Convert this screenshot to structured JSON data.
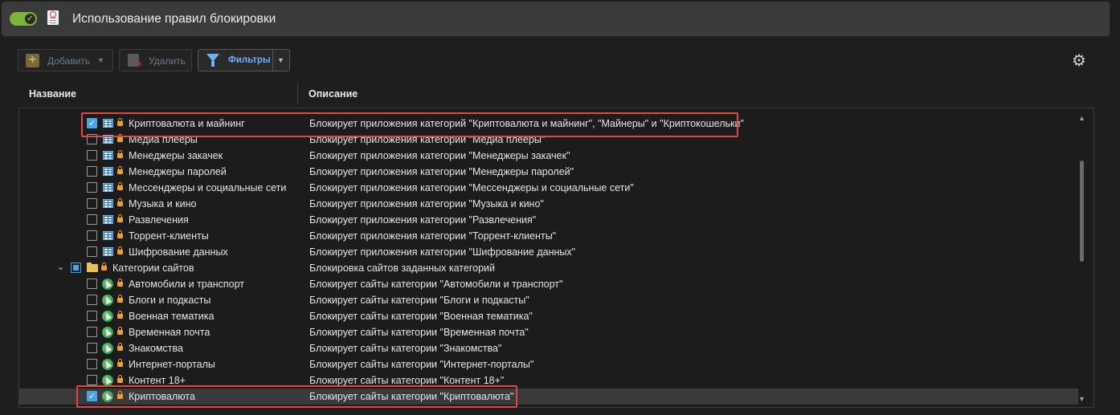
{
  "header": {
    "title": "Использование правил блокировки",
    "toggle_on": true
  },
  "toolbar": {
    "add_label": "Добавить",
    "delete_label": "Удалить",
    "filters_label": "Фильтры"
  },
  "columns": {
    "name": "Название",
    "description": "Описание"
  },
  "rows": [
    {
      "name": "Криптовалюта и майнинг",
      "desc": "Блокирует приложения категорий \"Криптовалюта и майнинг\", \"Майнеры\" и \"Криптокошельки\"",
      "checked": true,
      "icon": "app-icon"
    },
    {
      "name": "Медиа плееры",
      "desc": "Блокирует приложения категории \"Медиа плееры\"",
      "checked": false,
      "icon": "app-icon"
    },
    {
      "name": "Менеджеры закачек",
      "desc": "Блокирует приложения категории \"Менеджеры закачек\"",
      "checked": false,
      "icon": "app-icon"
    },
    {
      "name": "Менеджеры паролей",
      "desc": "Блокирует приложения категории \"Менеджеры паролей\"",
      "checked": false,
      "icon": "app-icon"
    },
    {
      "name": "Мессенджеры и социальные сети",
      "desc": "Блокирует приложения категории \"Мессенджеры и социальные сети\"",
      "checked": false,
      "icon": "app-icon"
    },
    {
      "name": "Музыка и кино",
      "desc": "Блокирует приложения категории \"Музыка и кино\"",
      "checked": false,
      "icon": "app-icon"
    },
    {
      "name": "Развлечения",
      "desc": "Блокирует приложения категории \"Развлечения\"",
      "checked": false,
      "icon": "app-icon"
    },
    {
      "name": "Торрент-клиенты",
      "desc": "Блокирует приложения категории \"Торрент-клиенты\"",
      "checked": false,
      "icon": "app-icon"
    },
    {
      "name": "Шифрование данных",
      "desc": "Блокирует приложения категории \"Шифрование данных\"",
      "checked": false,
      "icon": "app-icon"
    },
    {
      "name": "Категории сайтов",
      "desc": "Блокировка сайтов заданных категорий",
      "checked": "partial",
      "icon": "folder-icon",
      "group": true
    },
    {
      "name": "Автомобили и транспорт",
      "desc": "Блокирует сайты категории \"Автомобили и транспорт\"",
      "checked": false,
      "icon": "web-icon"
    },
    {
      "name": "Блоги и подкасты",
      "desc": "Блокирует сайты категории \"Блоги и подкасты\"",
      "checked": false,
      "icon": "web-icon"
    },
    {
      "name": "Военная тематика",
      "desc": "Блокирует сайты категории \"Военная тематика\"",
      "checked": false,
      "icon": "web-icon"
    },
    {
      "name": "Временная почта",
      "desc": "Блокирует сайты категории \"Временная почта\"",
      "checked": false,
      "icon": "web-icon"
    },
    {
      "name": "Знакомства",
      "desc": "Блокирует сайты категории \"Знакомства\"",
      "checked": false,
      "icon": "web-icon"
    },
    {
      "name": "Интернет-порталы",
      "desc": "Блокирует сайты категории \"Интернет-порталы\"",
      "checked": false,
      "icon": "web-icon"
    },
    {
      "name": "Контент 18+",
      "desc": "Блокирует сайты категории \"Контент 18+\"",
      "checked": false,
      "icon": "web-icon"
    },
    {
      "name": "Криптовалюта",
      "desc": "Блокирует сайты категории \"Криптовалюта\"",
      "checked": true,
      "icon": "web-icon",
      "selected": true
    }
  ],
  "colors": {
    "accent": "#4aa3e8",
    "toggle": "#7fb33a",
    "highlight": "#e04848"
  }
}
